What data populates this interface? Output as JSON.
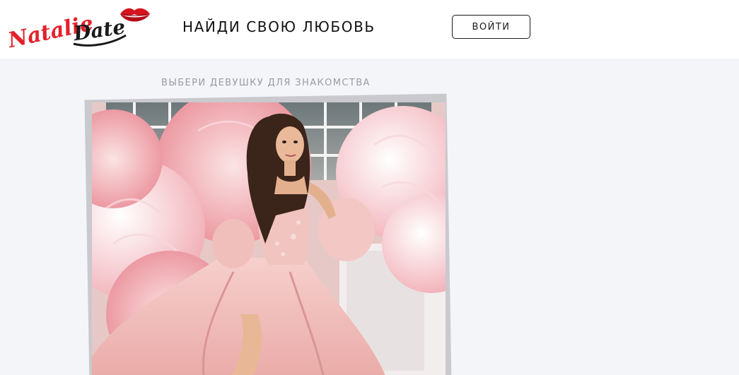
{
  "header": {
    "logo_text": "NatalieDate",
    "tagline": "НАЙДИ СВОЮ ЛЮБОВЬ",
    "login_label": "ВОЙТИ"
  },
  "main": {
    "section_title": "ВЫБЕРИ ДЕВУШКУ ДЛЯ ЗНАКОМСТВА",
    "profile_photo": {
      "description_icon": "profile-photo"
    }
  },
  "colors": {
    "logo_red": "#e3212b",
    "logo_dark": "#1a1a1a",
    "page_bg": "#f4f5f9"
  }
}
